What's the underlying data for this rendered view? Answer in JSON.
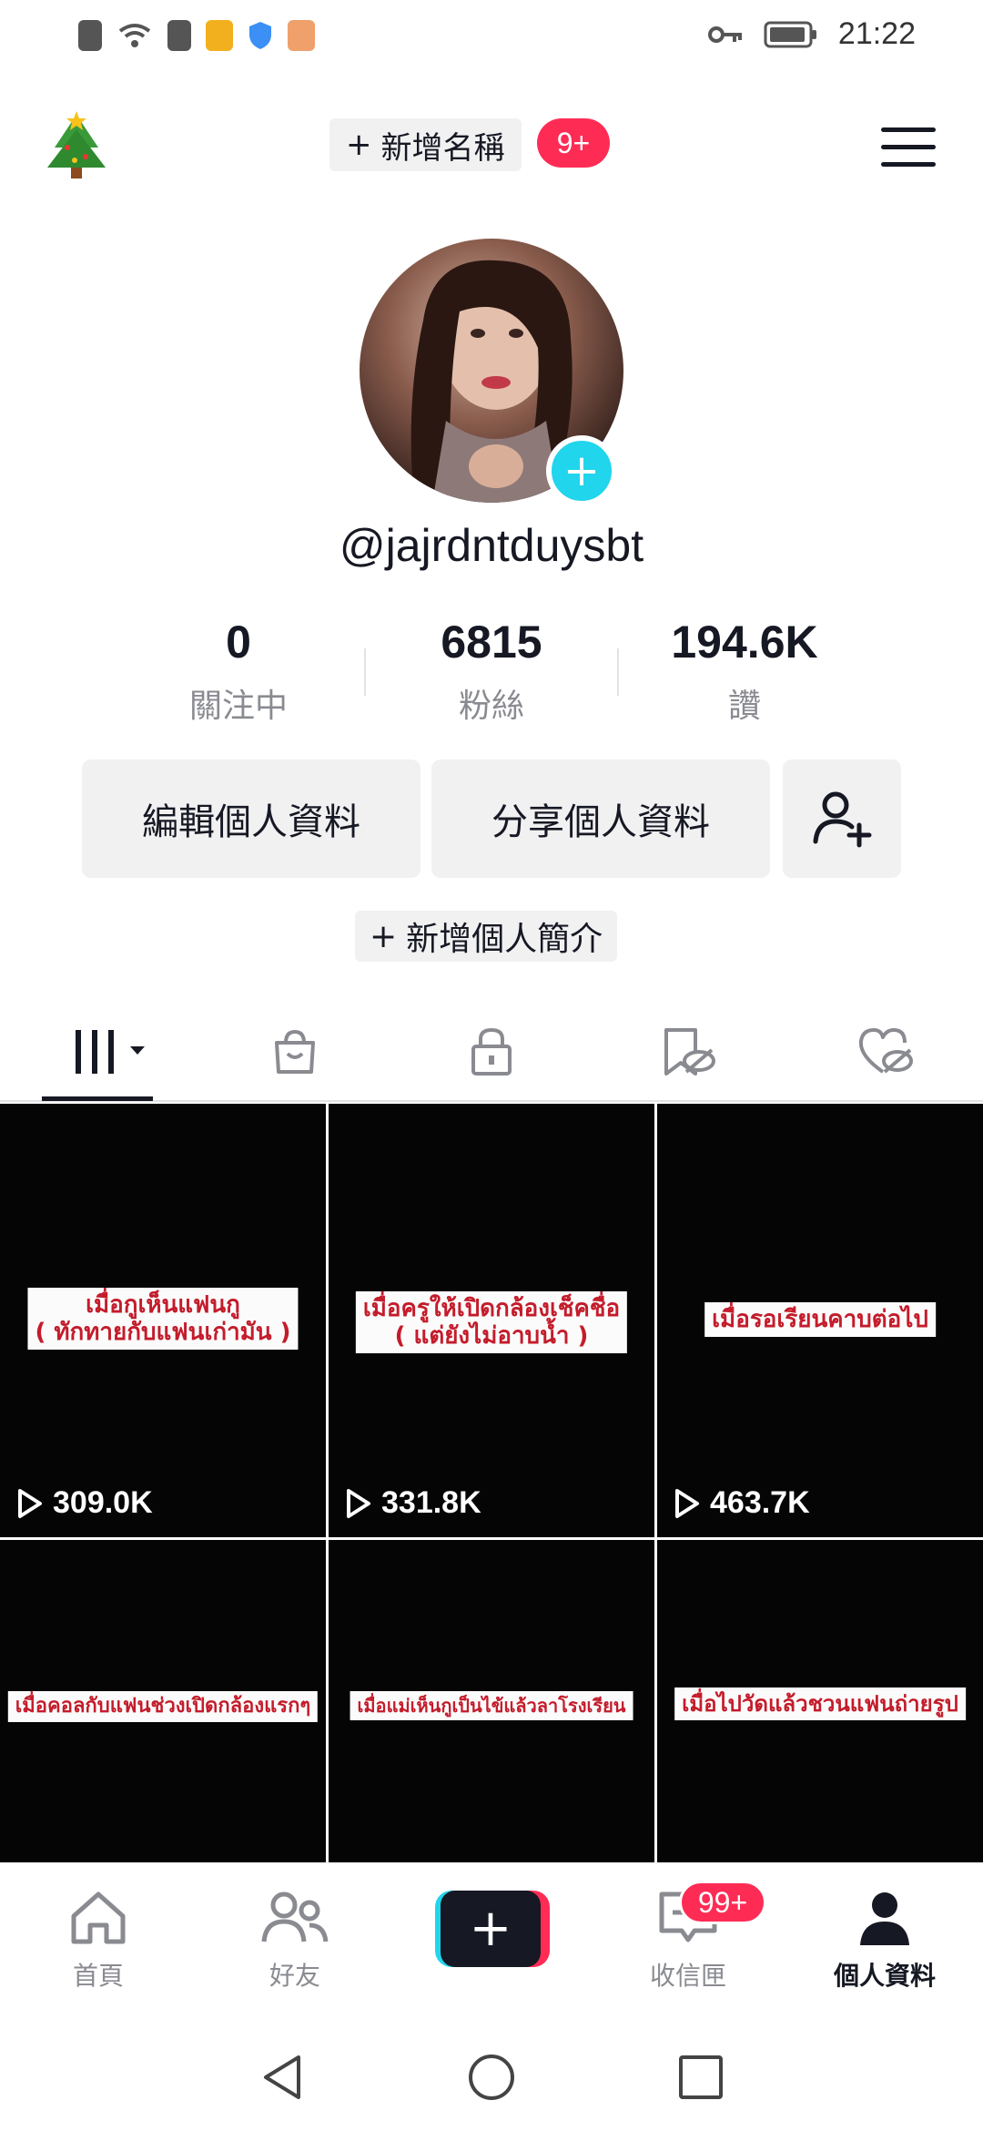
{
  "status_bar": {
    "time": "21:22"
  },
  "header": {
    "add_name_plus": "+",
    "add_name_label": "新增名稱",
    "notification_badge": "9+"
  },
  "profile": {
    "username": "@jajrdntduysbt",
    "stats": [
      {
        "value": "0",
        "label": "關注中"
      },
      {
        "value": "6815",
        "label": "粉絲"
      },
      {
        "value": "194.6K",
        "label": "讚"
      }
    ],
    "edit_profile_label": "編輯個人資料",
    "share_profile_label": "分享個人資料",
    "bio_add_plus": "+",
    "bio_add_label": "新增個人簡介"
  },
  "videos": [
    {
      "caption_line1": "เมื่อกูเห็นแฟนกู",
      "caption_line2": "( ทักทายกับแฟนเก่ามัน )",
      "views": "309.0K"
    },
    {
      "caption_line1": "เมื่อครูให้เปิดกล้องเช็คชื่อ",
      "caption_line2": "( แต่ยังไม่อาบน้ำ )",
      "views": "331.8K"
    },
    {
      "caption_line1": "เมื่อรอเรียนคาบต่อไป",
      "caption_line2": "",
      "views": "463.7K"
    },
    {
      "caption_line1": "เมื่อคอลกับแฟนช่วงเปิดกล้องแรกๆ",
      "caption_line2": "",
      "views": ""
    },
    {
      "caption_line1": "เมื่อแม่เห็นกูเป็นไข้แล้วลาโรงเรียน",
      "caption_line2": "",
      "views": ""
    },
    {
      "caption_line1": "เมื่อไปวัดแล้วชวนแฟนถ่ายรูป",
      "caption_line2": "",
      "views": ""
    }
  ],
  "bottom_nav": {
    "home_label": "首頁",
    "friends_label": "好友",
    "create_label": "+",
    "inbox_label": "收信匣",
    "inbox_badge": "99+",
    "profile_label": "個人資料"
  },
  "colors": {
    "accent_red": "#fe2c55",
    "accent_cyan": "#20d5ec",
    "text_primary": "#161823",
    "text_secondary": "#8a8b91"
  }
}
